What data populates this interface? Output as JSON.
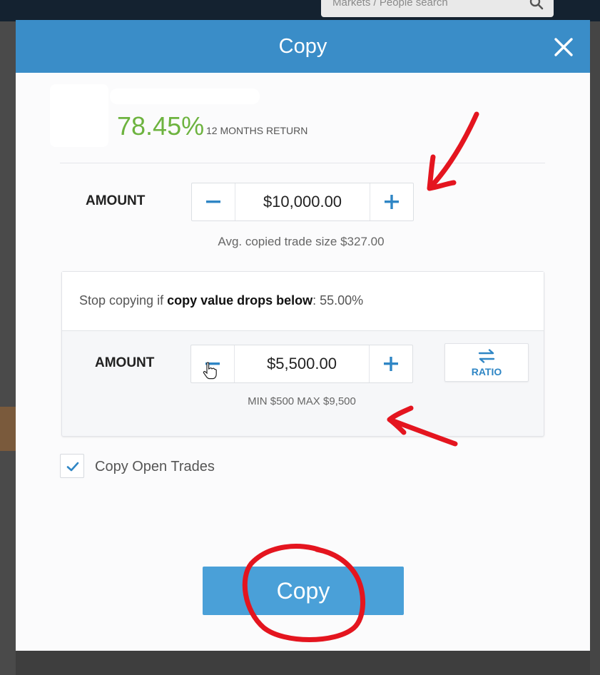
{
  "background": {
    "search_placeholder": "Markets / People search"
  },
  "modal": {
    "title": "Copy"
  },
  "trader": {
    "return_value": "78.45%",
    "return_label": "12 MONTHS RETURN"
  },
  "amount": {
    "label": "AMOUNT",
    "value": "$10,000.00",
    "hint": "Avg. copied trade size $327.00"
  },
  "stop_loss": {
    "prefix": "Stop copying if ",
    "bold_text": "copy value drops below",
    "suffix": ": 55.00%",
    "amount_label": "AMOUNT",
    "amount_value": "$5,500.00",
    "range_hint": "MIN $500 MAX $9,500",
    "ratio_label": "RATIO"
  },
  "copy_open_trades": {
    "label": "Copy Open Trades",
    "checked": true
  },
  "copy_button": {
    "label": "Copy"
  },
  "colors": {
    "header": "#3a8dc8",
    "accent": "#2f86c5",
    "return_green": "#6db33f",
    "button": "#4aa0d8",
    "annotation_red": "#e4151f"
  },
  "icons": [
    "search-icon",
    "close-icon",
    "minus-icon",
    "plus-icon",
    "swap-arrows-icon",
    "hand-cursor-icon",
    "checkmark-icon"
  ]
}
